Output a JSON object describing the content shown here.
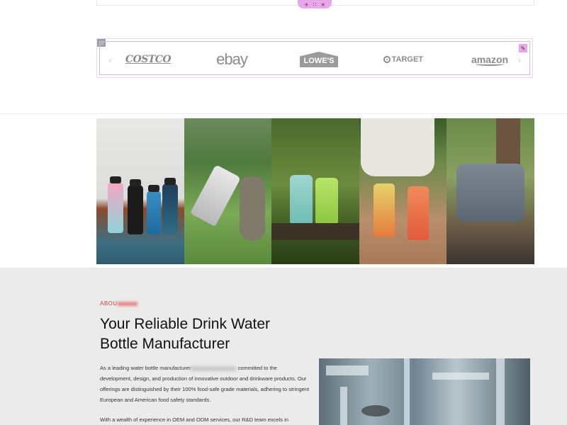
{
  "editor": {
    "handle_icons": [
      "plus-icon",
      "drag-icon",
      "close-icon"
    ],
    "handle_glyphs": [
      "+",
      "∷",
      "×"
    ],
    "widget_glyph": "▭",
    "edit_glyph": "✎",
    "accent_color": "#e7a7e8"
  },
  "logos": {
    "prev_glyph": "‹",
    "next_glyph": "›",
    "items": [
      {
        "name": "costco",
        "text": "COSTCO"
      },
      {
        "name": "ebay",
        "text": "ebay"
      },
      {
        "name": "lowes",
        "text": "LOWE'S"
      },
      {
        "name": "target",
        "text": "TARGET"
      },
      {
        "name": "amazon",
        "text": "amazon"
      }
    ]
  },
  "about": {
    "label": "ABOU",
    "title": "Your Reliable Drink Water Bottle Manufacturer",
    "paragraph1_before": "As a leading water bottle manufacturer",
    "paragraph1_after": "committed to the development, design, and production of innovative outdoor and drinkware products. Our offerings are distinguished by their 100% food-safe grade materials, adhering to stringent European and American food safety standards.",
    "paragraph2": "With a wealth of experience in OEM and ODM services, our R&D team excels in",
    "label_color": "#d33f3f"
  }
}
